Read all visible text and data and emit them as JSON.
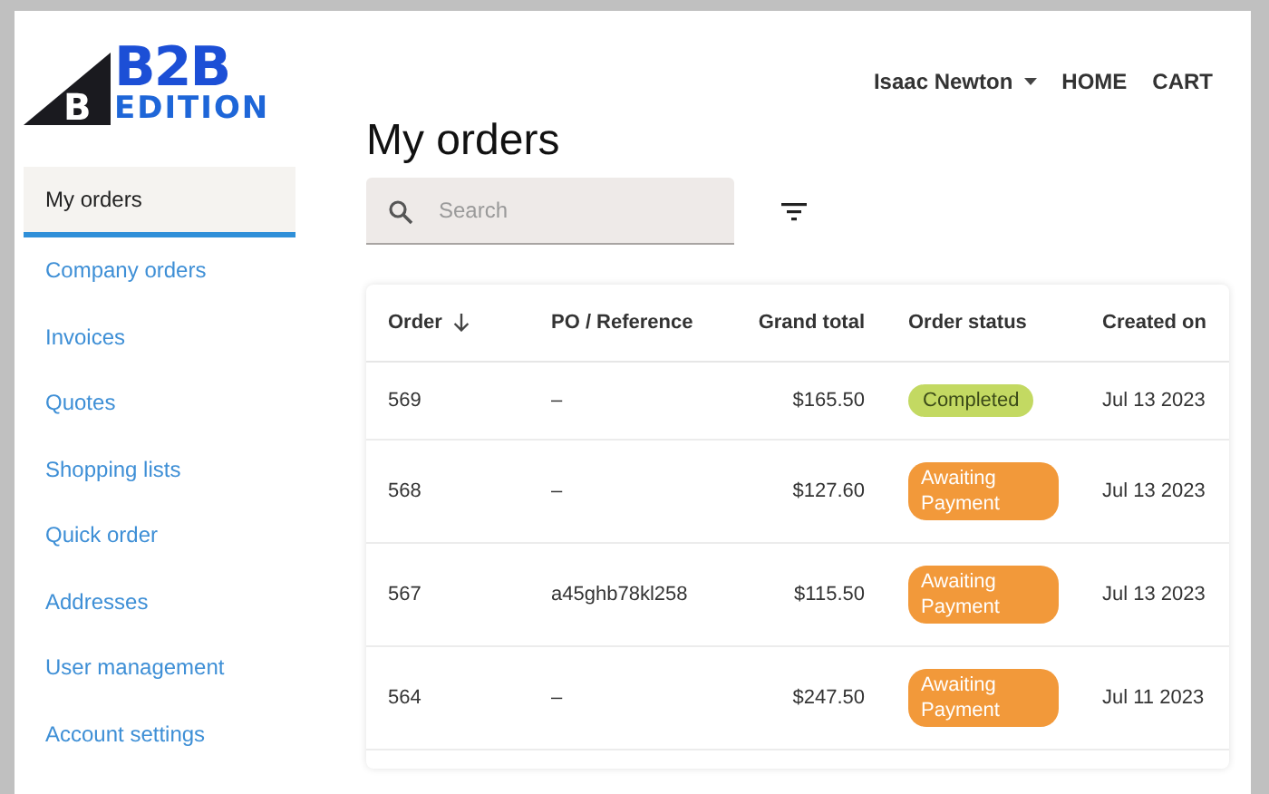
{
  "logo": {
    "mark": "B",
    "title": "B2B",
    "subtitle": "EDITION"
  },
  "header": {
    "user": "Isaac Newton",
    "links": [
      "HOME",
      "CART"
    ]
  },
  "sidebar": {
    "items": [
      {
        "label": "My orders",
        "selected": true
      },
      {
        "label": "Company orders",
        "selected": false
      },
      {
        "label": "Invoices",
        "selected": false
      },
      {
        "label": "Quotes",
        "selected": false
      },
      {
        "label": "Shopping lists",
        "selected": false
      },
      {
        "label": "Quick order",
        "selected": false
      },
      {
        "label": "Addresses",
        "selected": false
      },
      {
        "label": "User management",
        "selected": false
      },
      {
        "label": "Account settings",
        "selected": false
      }
    ]
  },
  "page_title": "My orders",
  "search": {
    "placeholder": "Search"
  },
  "table": {
    "columns": [
      "Order",
      "PO / Reference",
      "Grand total",
      "Order status",
      "Created on"
    ],
    "rows": [
      {
        "order": "569",
        "reference": "–",
        "total": "$165.50",
        "status": {
          "kind": "completed",
          "label": "Completed"
        },
        "created": "Jul 13 2023"
      },
      {
        "order": "568",
        "reference": "–",
        "total": "$127.60",
        "status": {
          "kind": "awaiting",
          "label": "Awaiting Payment"
        },
        "created": "Jul 13 2023"
      },
      {
        "order": "567",
        "reference": "a45ghb78kl258",
        "total": "$115.50",
        "status": {
          "kind": "awaiting",
          "label": "Awaiting Payment"
        },
        "created": "Jul 13 2023"
      },
      {
        "order": "564",
        "reference": "–",
        "total": "$247.50",
        "status": {
          "kind": "awaiting",
          "label": "Awaiting Payment"
        },
        "created": "Jul 11 2023"
      }
    ]
  }
}
